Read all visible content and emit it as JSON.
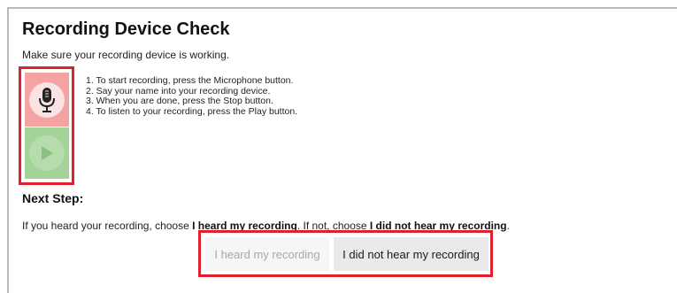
{
  "page": {
    "title": "Recording Device Check",
    "subtitle": "Make sure your recording device is working."
  },
  "instructions": [
    "1. To start recording, press the Microphone button.",
    "2. Say your name into your recording device.",
    "3. When you are done, press the Stop button.",
    "4. To listen to your recording, press the Play button."
  ],
  "controls": {
    "microphone_icon": "microphone-icon",
    "play_icon": "play-icon"
  },
  "next_step": {
    "heading": "Next Step:",
    "hint_prefix": "If you heard your recording, choose ",
    "hint_heard_bold": "I heard my recording",
    "hint_middle": ". If not, choose ",
    "hint_not_heard_bold": "I did not hear my recording",
    "hint_suffix": "."
  },
  "buttons": {
    "heard": "I heard my recording",
    "not_heard": "I did not hear my recording"
  },
  "colors": {
    "highlight": "#e0202c",
    "mic_panel": "#f4a2a2",
    "play_panel": "#a4d39a"
  }
}
